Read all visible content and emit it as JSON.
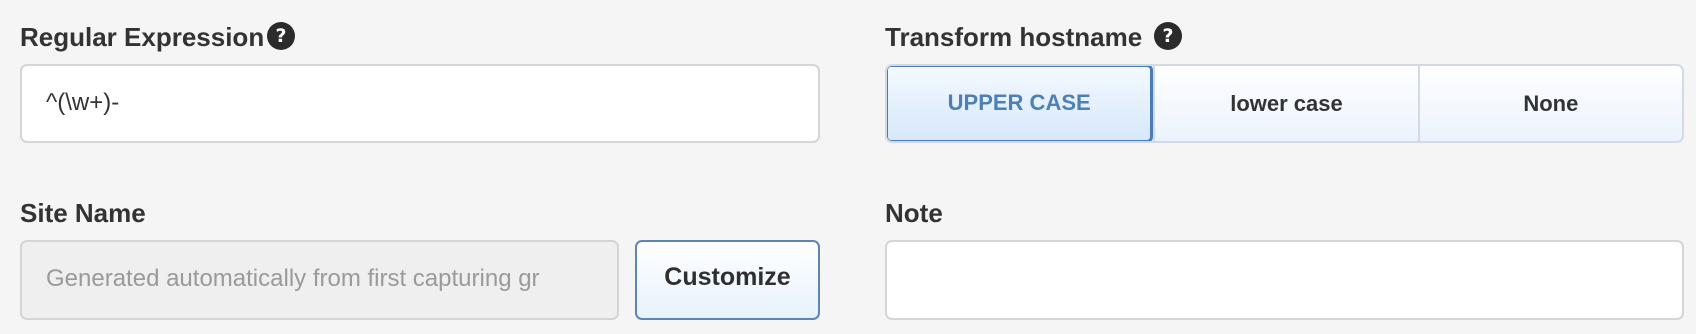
{
  "regex": {
    "label": "Regular Expression",
    "value": "^(\\w+)-"
  },
  "transform": {
    "label": "Transform hostname",
    "options": [
      "UPPER CASE",
      "lower case",
      "None"
    ],
    "selected": "UPPER CASE"
  },
  "site_name": {
    "label": "Site Name",
    "placeholder": "Generated automatically from first capturing gr",
    "value": "",
    "button_label": "Customize"
  },
  "note": {
    "label": "Note",
    "value": ""
  },
  "help_icon_glyph": "?",
  "colors": {
    "background": "#f5f5f5",
    "accent": "#4a7db8",
    "active_text": "#4e7fb5"
  }
}
